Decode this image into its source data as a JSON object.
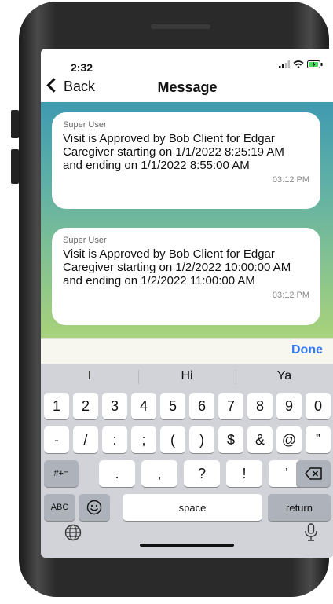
{
  "status_bar": {
    "time": "2:32"
  },
  "nav": {
    "back_label": "Back",
    "title": "Message"
  },
  "messages": [
    {
      "sender": "Super User",
      "text": "Visit is Approved by Bob  Client for Edgar Caregiver starting on 1/1/2022 8:25:19 AM and ending on 1/1/2022 8:55:00 AM",
      "time": "03:12 PM"
    },
    {
      "sender": "Super User",
      "text": "Visit is Approved by Bob  Client for Edgar Caregiver starting on 1/2/2022 10:00:00 AM and ending on 1/2/2022 11:00:00 AM",
      "time": "03:12 PM"
    }
  ],
  "keyboard": {
    "done_label": "Done",
    "suggestions": [
      "I",
      "Hi",
      "Ya"
    ],
    "row1": [
      "1",
      "2",
      "3",
      "4",
      "5",
      "6",
      "7",
      "8",
      "9",
      "0"
    ],
    "row2": [
      "-",
      "/",
      ":",
      ";",
      "(",
      ")",
      "$",
      "&",
      "@",
      "”"
    ],
    "row3_mode": "#+=",
    "row3": [
      ".",
      ",",
      "?",
      "!",
      "’"
    ],
    "abc_label": "ABC",
    "space_label": "space",
    "return_label": "return",
    "icons": {
      "delete": "backspace-icon",
      "emoji": "emoji-icon",
      "globe": "globe-icon",
      "mic": "microphone-icon"
    }
  },
  "colors": {
    "accent": "#3478f6",
    "keyboard_bg": "#d1d3d9",
    "chat_top": "#3f9ab0",
    "chat_bottom": "#a9d27a"
  }
}
